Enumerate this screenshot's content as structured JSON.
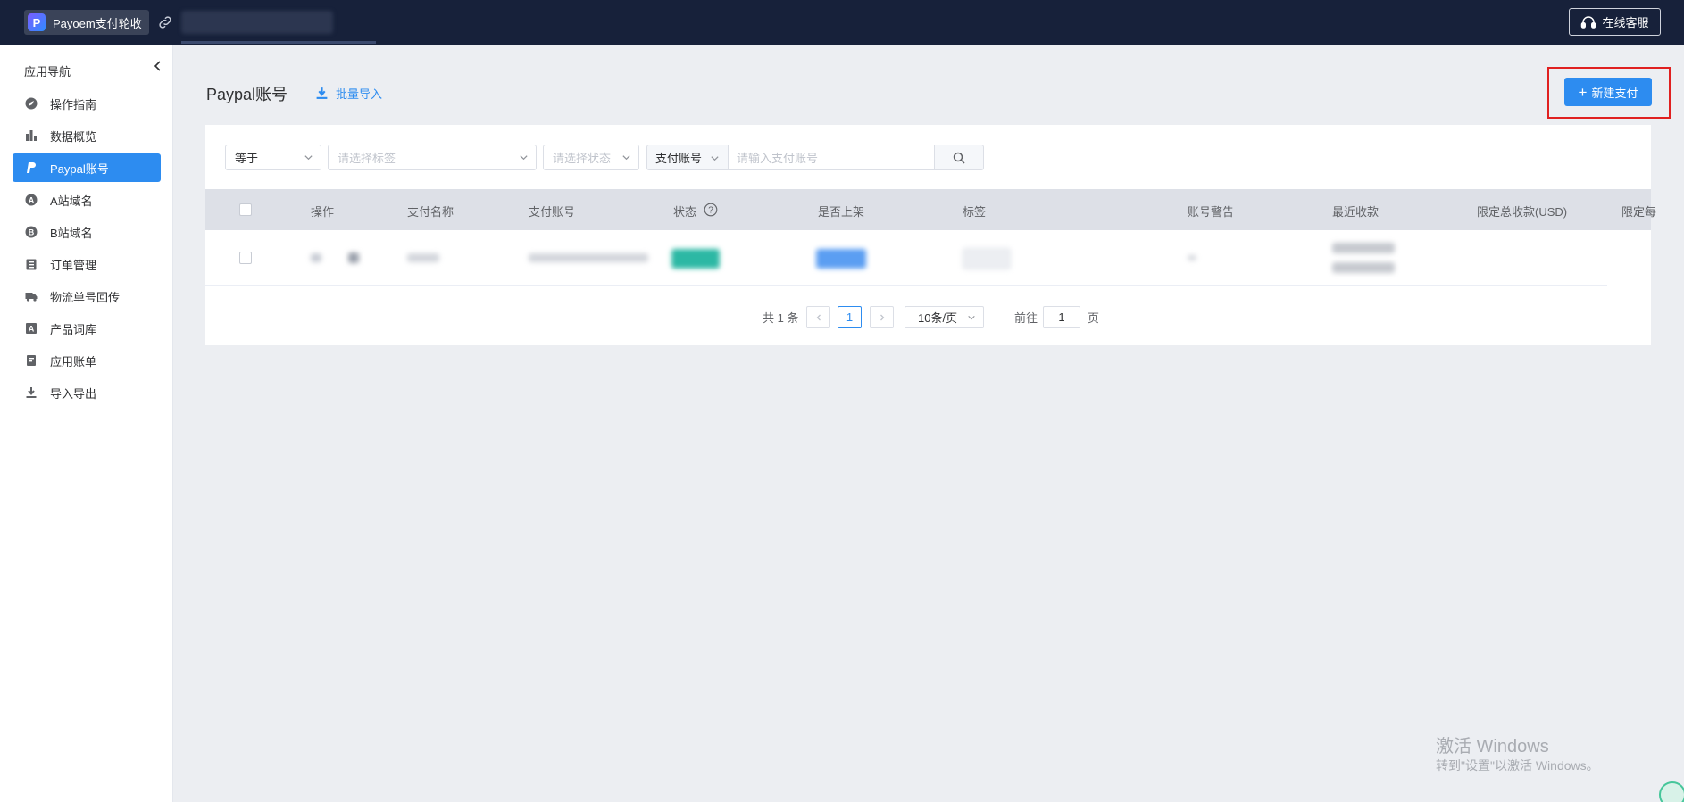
{
  "topbar": {
    "brand_logo": "P",
    "brand_name": "Payoem支付轮收",
    "service_label": "在线客服",
    "icons": [
      "link-icon",
      "headset-icon"
    ]
  },
  "sidebar": {
    "title": "应用导航",
    "items": [
      {
        "label": "操作指南",
        "icon": "compass-icon",
        "active": false
      },
      {
        "label": "数据概览",
        "icon": "bar-chart-icon",
        "active": false
      },
      {
        "label": "Paypal账号",
        "icon": "paypal-icon",
        "active": true
      },
      {
        "label": "A站域名",
        "icon": "a-circle-icon",
        "active": false
      },
      {
        "label": "B站域名",
        "icon": "b-circle-icon",
        "active": false
      },
      {
        "label": "订单管理",
        "icon": "clipboard-icon",
        "active": false
      },
      {
        "label": "物流单号回传",
        "icon": "truck-icon",
        "active": false
      },
      {
        "label": "产品词库",
        "icon": "font-box-icon",
        "active": false
      },
      {
        "label": "应用账单",
        "icon": "bill-icon",
        "active": false
      },
      {
        "label": "导入导出",
        "icon": "download-icon",
        "active": false
      }
    ]
  },
  "header": {
    "title": "Paypal账号",
    "import_label": "批量导入",
    "new_button": "新建支付"
  },
  "filters": {
    "match_select": "等于",
    "tag_placeholder": "请选择标签",
    "status_placeholder": "请选择状态",
    "field_select": "支付账号",
    "account_placeholder": "请输入支付账号"
  },
  "table": {
    "columns": [
      "操作",
      "支付名称",
      "支付账号",
      "状态",
      "是否上架",
      "标签",
      "账号警告",
      "最近收款",
      "限定总收款(USD)",
      "限定每"
    ]
  },
  "pagination": {
    "total_text": "共 1 条",
    "current_page": "1",
    "page_size": "10条/页",
    "goto_label": "前往",
    "goto_value": "1",
    "page_unit": "页"
  },
  "watermark": {
    "line1": "激活 Windows",
    "line2": "转到\"设置\"以激活 Windows。"
  },
  "colors": {
    "topbar": "#17213a",
    "primary": "#2d8cf0",
    "background": "#eceef2",
    "table_header": "#dde0e7",
    "highlight_border": "#e02020"
  }
}
